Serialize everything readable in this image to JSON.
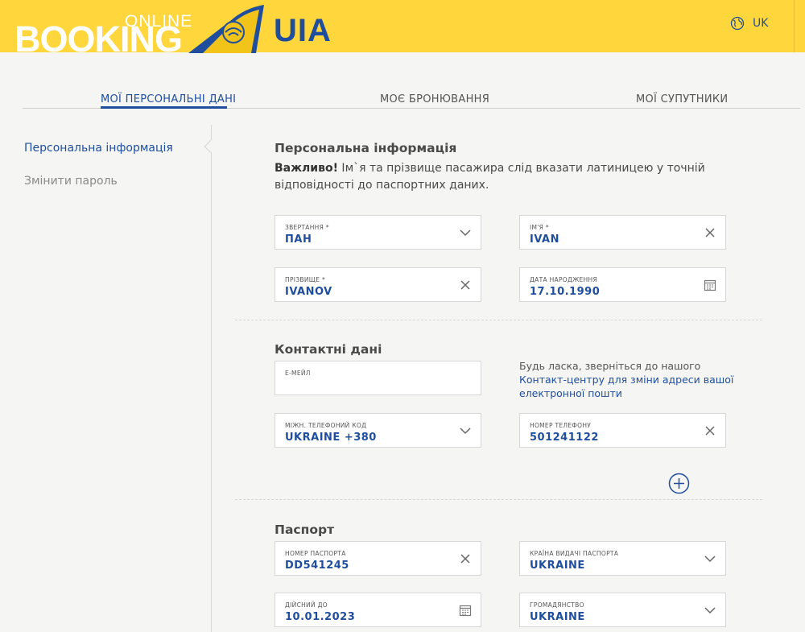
{
  "header": {
    "logo_online": "ONLINE",
    "logo_booking": "BOOKING",
    "logo_brand": "UIA",
    "language": "UK"
  },
  "tabs": [
    {
      "label": "МОЇ ПЕРСОНАЛЬНІ ДАНІ",
      "active": true
    },
    {
      "label": "МОЄ БРОНЮВАННЯ",
      "active": false
    },
    {
      "label": "МОЇ СУПУТНИКИ",
      "active": false
    }
  ],
  "sidebar": {
    "items": [
      {
        "label": "Персональна інформація",
        "active": true
      },
      {
        "label": "Змінити пароль",
        "active": false
      }
    ]
  },
  "personal": {
    "title": "Персональна інформація",
    "notice_bold": "Важливо!",
    "notice_text": " Ім`я та прізвище пасажира слід вказати латиницею у точній відповідності до паспортних даних.",
    "salutation": {
      "label": "ЗВЕРТАННЯ *",
      "value": "ПАН"
    },
    "first_name": {
      "label": "ІМ'Я *",
      "value": "IVAN"
    },
    "last_name": {
      "label": "ПРІЗВИЩЕ *",
      "value": "IVANOV"
    },
    "birth_date": {
      "label": "ДАТА НАРОДЖЕННЯ",
      "value": "17.10.1990"
    }
  },
  "contacts": {
    "title": "Контактні дані",
    "email": {
      "label": "Е-МЕЙЛ",
      "value": ""
    },
    "note_text": "Будь ласка, зверніться до нашого ",
    "note_link": "Контакт-центру для зміни адреси вашої електронної пошти",
    "phone_code": {
      "label": "МІЖН. ТЕЛЕФОНИЙ КОД",
      "value": "UKRAINE +380"
    },
    "phone_number": {
      "label": "НОМЕР ТЕЛЕФОНУ",
      "value": "501241122"
    }
  },
  "passport": {
    "title": "Паспорт",
    "number": {
      "label": "НОМЕР ПАСПОРТА",
      "value": "DD541245"
    },
    "issue_country": {
      "label": "КРАЇНА ВИДАЧІ ПАСПОРТА",
      "value": "UKRAINE"
    },
    "valid_until": {
      "label": "ДІЙСНИЙ ДО",
      "value": "10.01.2023"
    },
    "citizenship": {
      "label": "ГРОМАДЯНСТВО",
      "value": "UKRAINE"
    }
  },
  "colors": {
    "header_bg": "#ffd73d",
    "brand_blue": "#1f4e9e",
    "page_bg": "#f5f5f3"
  },
  "icons": {
    "globe": "globe-icon",
    "chevron": "chevron-down-icon",
    "clear": "close-icon",
    "calendar": "calendar-icon",
    "add": "plus-circle-icon"
  }
}
